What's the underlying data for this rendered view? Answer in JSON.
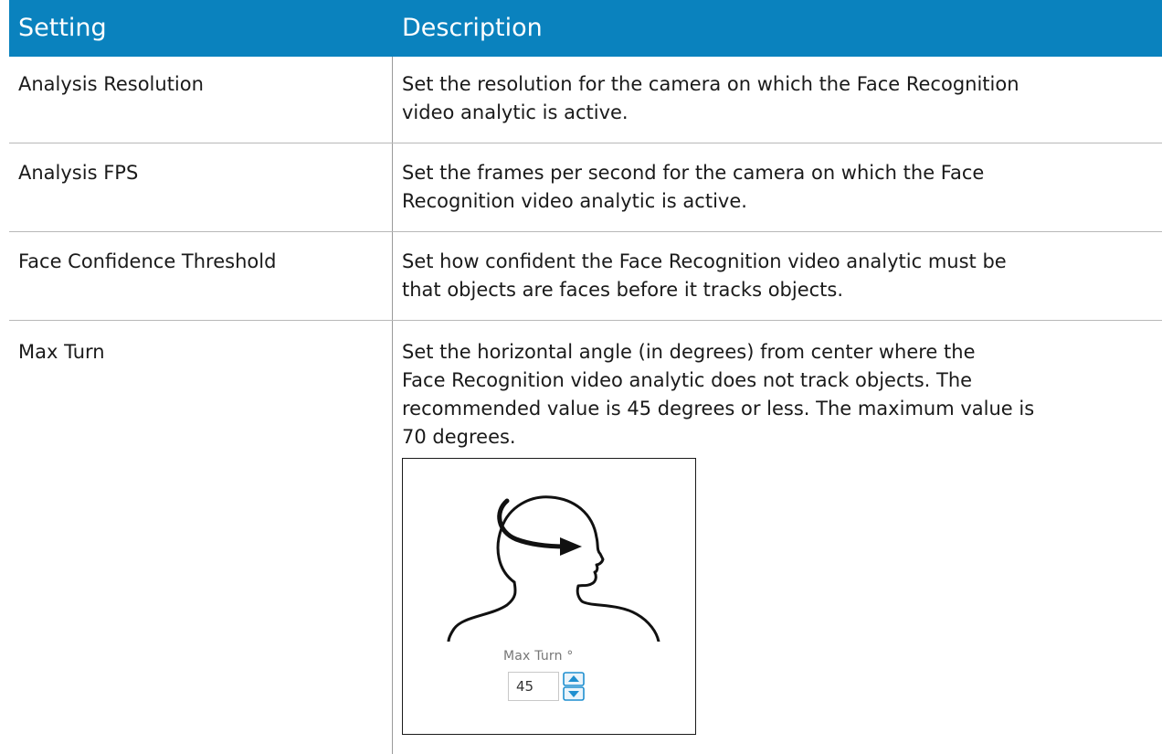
{
  "table": {
    "headers": {
      "setting": "Setting",
      "description": "Description"
    },
    "rows": [
      {
        "setting": "Analysis Resolution",
        "description_lines": [
          "Set the resolution for the camera on which the Face Recognition",
          "video analytic is active."
        ]
      },
      {
        "setting": "Analysis FPS",
        "description_lines": [
          "Set the frames per second for the camera on which the Face",
          "Recognition video analytic is active."
        ]
      },
      {
        "setting": "Face Confidence Threshold",
        "description_lines": [
          "Set how confident the Face Recognition video analytic must be",
          "that objects are faces before it tracks objects."
        ]
      },
      {
        "setting": "Max Turn",
        "description_lines": [
          "Set the horizontal angle (in degrees) from center where the",
          "Face Recognition video analytic does not track objects. The",
          "recommended value is 45 degrees or less. The maximum value is",
          "70 degrees."
        ]
      }
    ]
  },
  "figure": {
    "max_turn_label": "Max Turn °",
    "max_turn_value": "45"
  },
  "colors": {
    "header_background": "#0a82be",
    "spinner_accent": "#1f8fd0"
  },
  "icons": [
    "head-turn-illustration",
    "spinner-up-icon",
    "spinner-down-icon"
  ]
}
